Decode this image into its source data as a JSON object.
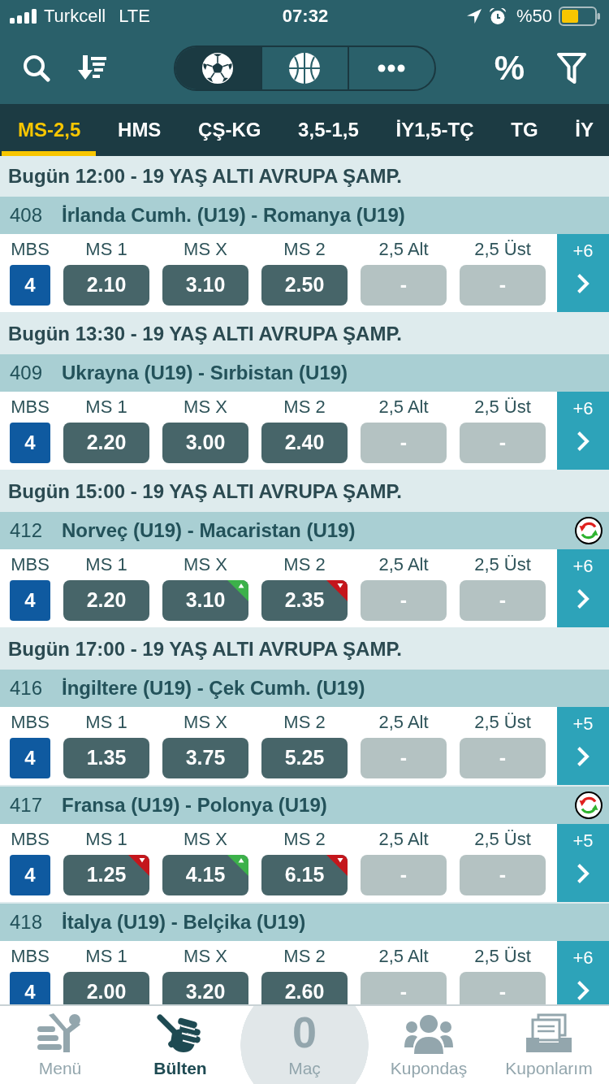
{
  "status_bar": {
    "carrier": "Turkcell",
    "network": "LTE",
    "time": "07:32",
    "battery": "%50"
  },
  "toolbar": {
    "odds_format": "%",
    "sports": [
      {
        "kind": "football",
        "selected": true
      },
      {
        "kind": "basketball",
        "selected": false
      },
      {
        "kind": "more",
        "selected": false
      }
    ]
  },
  "market_tabs": [
    {
      "label": "MS-2,5",
      "selected": true
    },
    {
      "label": "HMS",
      "selected": false
    },
    {
      "label": "ÇŞ-KG",
      "selected": false
    },
    {
      "label": "3,5-1,5",
      "selected": false
    },
    {
      "label": "İY1,5-TÇ",
      "selected": false
    },
    {
      "label": "TG",
      "selected": false
    },
    {
      "label": "İY",
      "selected": false
    }
  ],
  "sections": [
    {
      "header": "Bugün 12:00 - 19 YAŞ ALTI AVRUPA ŞAMP.",
      "matches": [
        {
          "code": "408",
          "teams": "İrlanda Cumh. (U19) - Romanya (U19)",
          "updated": false,
          "mbs_label": "MBS",
          "mbs": "4",
          "odds": [
            {
              "label": "MS 1",
              "value": "2.10",
              "disabled": false,
              "rising": false,
              "falling": false
            },
            {
              "label": "MS X",
              "value": "3.10",
              "disabled": false,
              "rising": false,
              "falling": false
            },
            {
              "label": "MS 2",
              "value": "2.50",
              "disabled": false,
              "rising": false,
              "falling": false
            },
            {
              "label": "2,5 Alt",
              "value": "-",
              "disabled": true,
              "rising": false,
              "falling": false
            },
            {
              "label": "2,5 Üst",
              "value": "-",
              "disabled": true,
              "rising": false,
              "falling": false
            }
          ],
          "more": "+6"
        }
      ]
    },
    {
      "header": "Bugün 13:30 - 19 YAŞ ALTI AVRUPA ŞAMP.",
      "matches": [
        {
          "code": "409",
          "teams": "Ukrayna (U19) - Sırbistan (U19)",
          "updated": false,
          "mbs_label": "MBS",
          "mbs": "4",
          "odds": [
            {
              "label": "MS 1",
              "value": "2.20",
              "disabled": false,
              "rising": false,
              "falling": false
            },
            {
              "label": "MS X",
              "value": "3.00",
              "disabled": false,
              "rising": false,
              "falling": false
            },
            {
              "label": "MS 2",
              "value": "2.40",
              "disabled": false,
              "rising": false,
              "falling": false
            },
            {
              "label": "2,5 Alt",
              "value": "-",
              "disabled": true,
              "rising": false,
              "falling": false
            },
            {
              "label": "2,5 Üst",
              "value": "-",
              "disabled": true,
              "rising": false,
              "falling": false
            }
          ],
          "more": "+6"
        }
      ]
    },
    {
      "header": "Bugün 15:00 - 19 YAŞ ALTI AVRUPA ŞAMP.",
      "matches": [
        {
          "code": "412",
          "teams": "Norveç (U19) - Macaristan (U19)",
          "updated": true,
          "mbs_label": "MBS",
          "mbs": "4",
          "odds": [
            {
              "label": "MS 1",
              "value": "2.20",
              "disabled": false,
              "rising": false,
              "falling": false
            },
            {
              "label": "MS X",
              "value": "3.10",
              "disabled": false,
              "rising": true,
              "falling": false
            },
            {
              "label": "MS 2",
              "value": "2.35",
              "disabled": false,
              "rising": false,
              "falling": true
            },
            {
              "label": "2,5 Alt",
              "value": "-",
              "disabled": true,
              "rising": false,
              "falling": false
            },
            {
              "label": "2,5 Üst",
              "value": "-",
              "disabled": true,
              "rising": false,
              "falling": false
            }
          ],
          "more": "+6"
        }
      ]
    },
    {
      "header": "Bugün 17:00 - 19 YAŞ ALTI AVRUPA ŞAMP.",
      "matches": [
        {
          "code": "416",
          "teams": "İngiltere (U19) - Çek Cumh. (U19)",
          "updated": false,
          "mbs_label": "MBS",
          "mbs": "4",
          "odds": [
            {
              "label": "MS 1",
              "value": "1.35",
              "disabled": false,
              "rising": false,
              "falling": false
            },
            {
              "label": "MS X",
              "value": "3.75",
              "disabled": false,
              "rising": false,
              "falling": false
            },
            {
              "label": "MS 2",
              "value": "5.25",
              "disabled": false,
              "rising": false,
              "falling": false
            },
            {
              "label": "2,5 Alt",
              "value": "-",
              "disabled": true,
              "rising": false,
              "falling": false
            },
            {
              "label": "2,5 Üst",
              "value": "-",
              "disabled": true,
              "rising": false,
              "falling": false
            }
          ],
          "more": "+5"
        },
        {
          "code": "417",
          "teams": "Fransa (U19) - Polonya (U19)",
          "updated": true,
          "mbs_label": "MBS",
          "mbs": "4",
          "odds": [
            {
              "label": "MS 1",
              "value": "1.25",
              "disabled": false,
              "rising": false,
              "falling": true
            },
            {
              "label": "MS X",
              "value": "4.15",
              "disabled": false,
              "rising": true,
              "falling": false
            },
            {
              "label": "MS 2",
              "value": "6.15",
              "disabled": false,
              "rising": false,
              "falling": true
            },
            {
              "label": "2,5 Alt",
              "value": "-",
              "disabled": true,
              "rising": false,
              "falling": false
            },
            {
              "label": "2,5 Üst",
              "value": "-",
              "disabled": true,
              "rising": false,
              "falling": false
            }
          ],
          "more": "+5"
        },
        {
          "code": "418",
          "teams": "İtalya (U19) - Belçika (U19)",
          "updated": false,
          "mbs_label": "MBS",
          "mbs": "4",
          "odds": [
            {
              "label": "MS 1",
              "value": "2.00",
              "disabled": false,
              "rising": false,
              "falling": false
            },
            {
              "label": "MS X",
              "value": "3.20",
              "disabled": false,
              "rising": false,
              "falling": false
            },
            {
              "label": "MS 2",
              "value": "2.60",
              "disabled": false,
              "rising": false,
              "falling": false
            },
            {
              "label": "2,5 Alt",
              "value": "-",
              "disabled": true,
              "rising": false,
              "falling": false
            },
            {
              "label": "2,5 Üst",
              "value": "-",
              "disabled": true,
              "rising": false,
              "falling": false
            }
          ],
          "more": "+6"
        }
      ]
    }
  ],
  "bottom_nav": [
    {
      "kind": "menu",
      "label": "Menü",
      "selected": false
    },
    {
      "kind": "bulletin",
      "label": "Bülten",
      "selected": true
    },
    {
      "kind": "counter",
      "count": "0",
      "label": "Maç",
      "selected": false
    },
    {
      "kind": "group",
      "label": "Kupondaş",
      "selected": false
    },
    {
      "kind": "coupons",
      "label": "Kuponlarım",
      "selected": false
    }
  ]
}
